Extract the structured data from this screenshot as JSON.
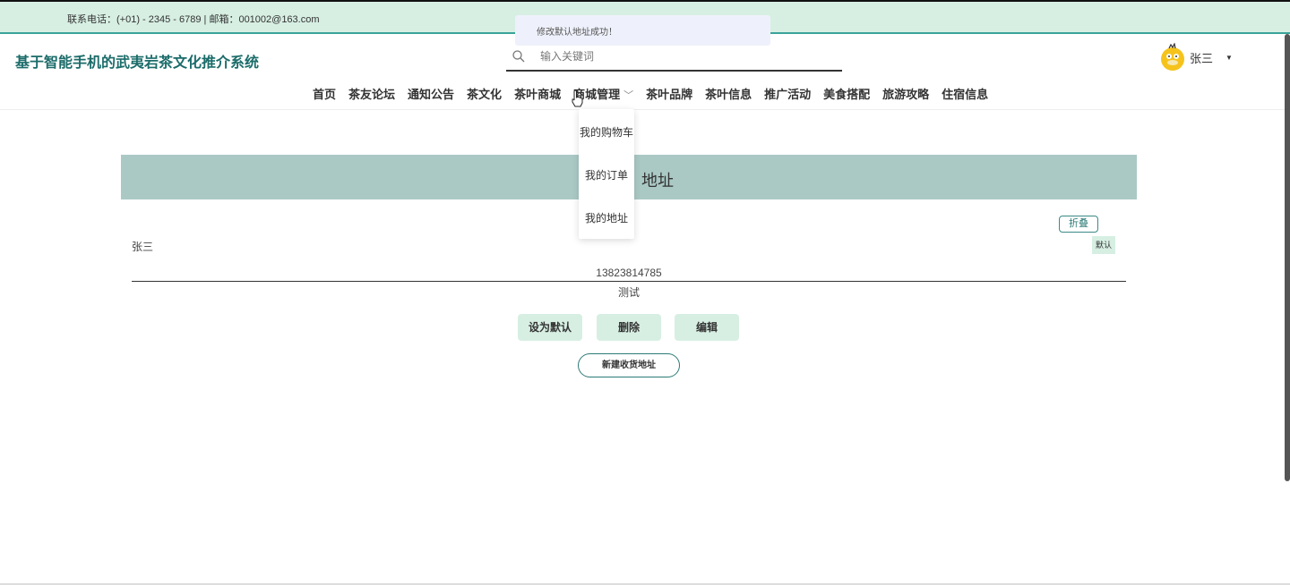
{
  "topbar": {
    "contact": "联系电话：(+01) - 2345 - 6789 | 邮箱：001002@163.com"
  },
  "toast": {
    "message": "修改默认地址成功！"
  },
  "header": {
    "site_title": "基于智能手机的武夷岩茶文化推介系统",
    "search": {
      "placeholder": "输入关键词",
      "icon": "search-icon"
    },
    "user": {
      "name": "张三",
      "avatar": "duck-avatar"
    }
  },
  "nav": {
    "items": [
      {
        "label": "首页"
      },
      {
        "label": "茶友论坛"
      },
      {
        "label": "通知公告"
      },
      {
        "label": "茶文化"
      },
      {
        "label": "茶叶商城"
      },
      {
        "label": "商城管理"
      },
      {
        "label": "茶叶品牌"
      },
      {
        "label": "茶叶信息"
      },
      {
        "label": "推广活动"
      },
      {
        "label": "美食搭配"
      },
      {
        "label": "旅游攻略"
      },
      {
        "label": "住宿信息"
      }
    ],
    "dropdown": [
      {
        "label": "我的购物车"
      },
      {
        "label": "我的订单"
      },
      {
        "label": "我的地址"
      }
    ]
  },
  "banner": {
    "title_visible": "地址"
  },
  "address": {
    "fold_label": "折叠",
    "default_tag": "默认",
    "name": "张三",
    "phone": "13823814785",
    "detail": "测试",
    "actions": {
      "set_default": "设为默认",
      "delete": "删除",
      "edit": "编辑"
    },
    "new_address": "新建收货地址"
  },
  "colors": {
    "topbar_bg": "#d7efe3",
    "accent": "#1b6c6a",
    "banner_bg": "#aac9c5",
    "button_bg": "#d7efe3"
  }
}
